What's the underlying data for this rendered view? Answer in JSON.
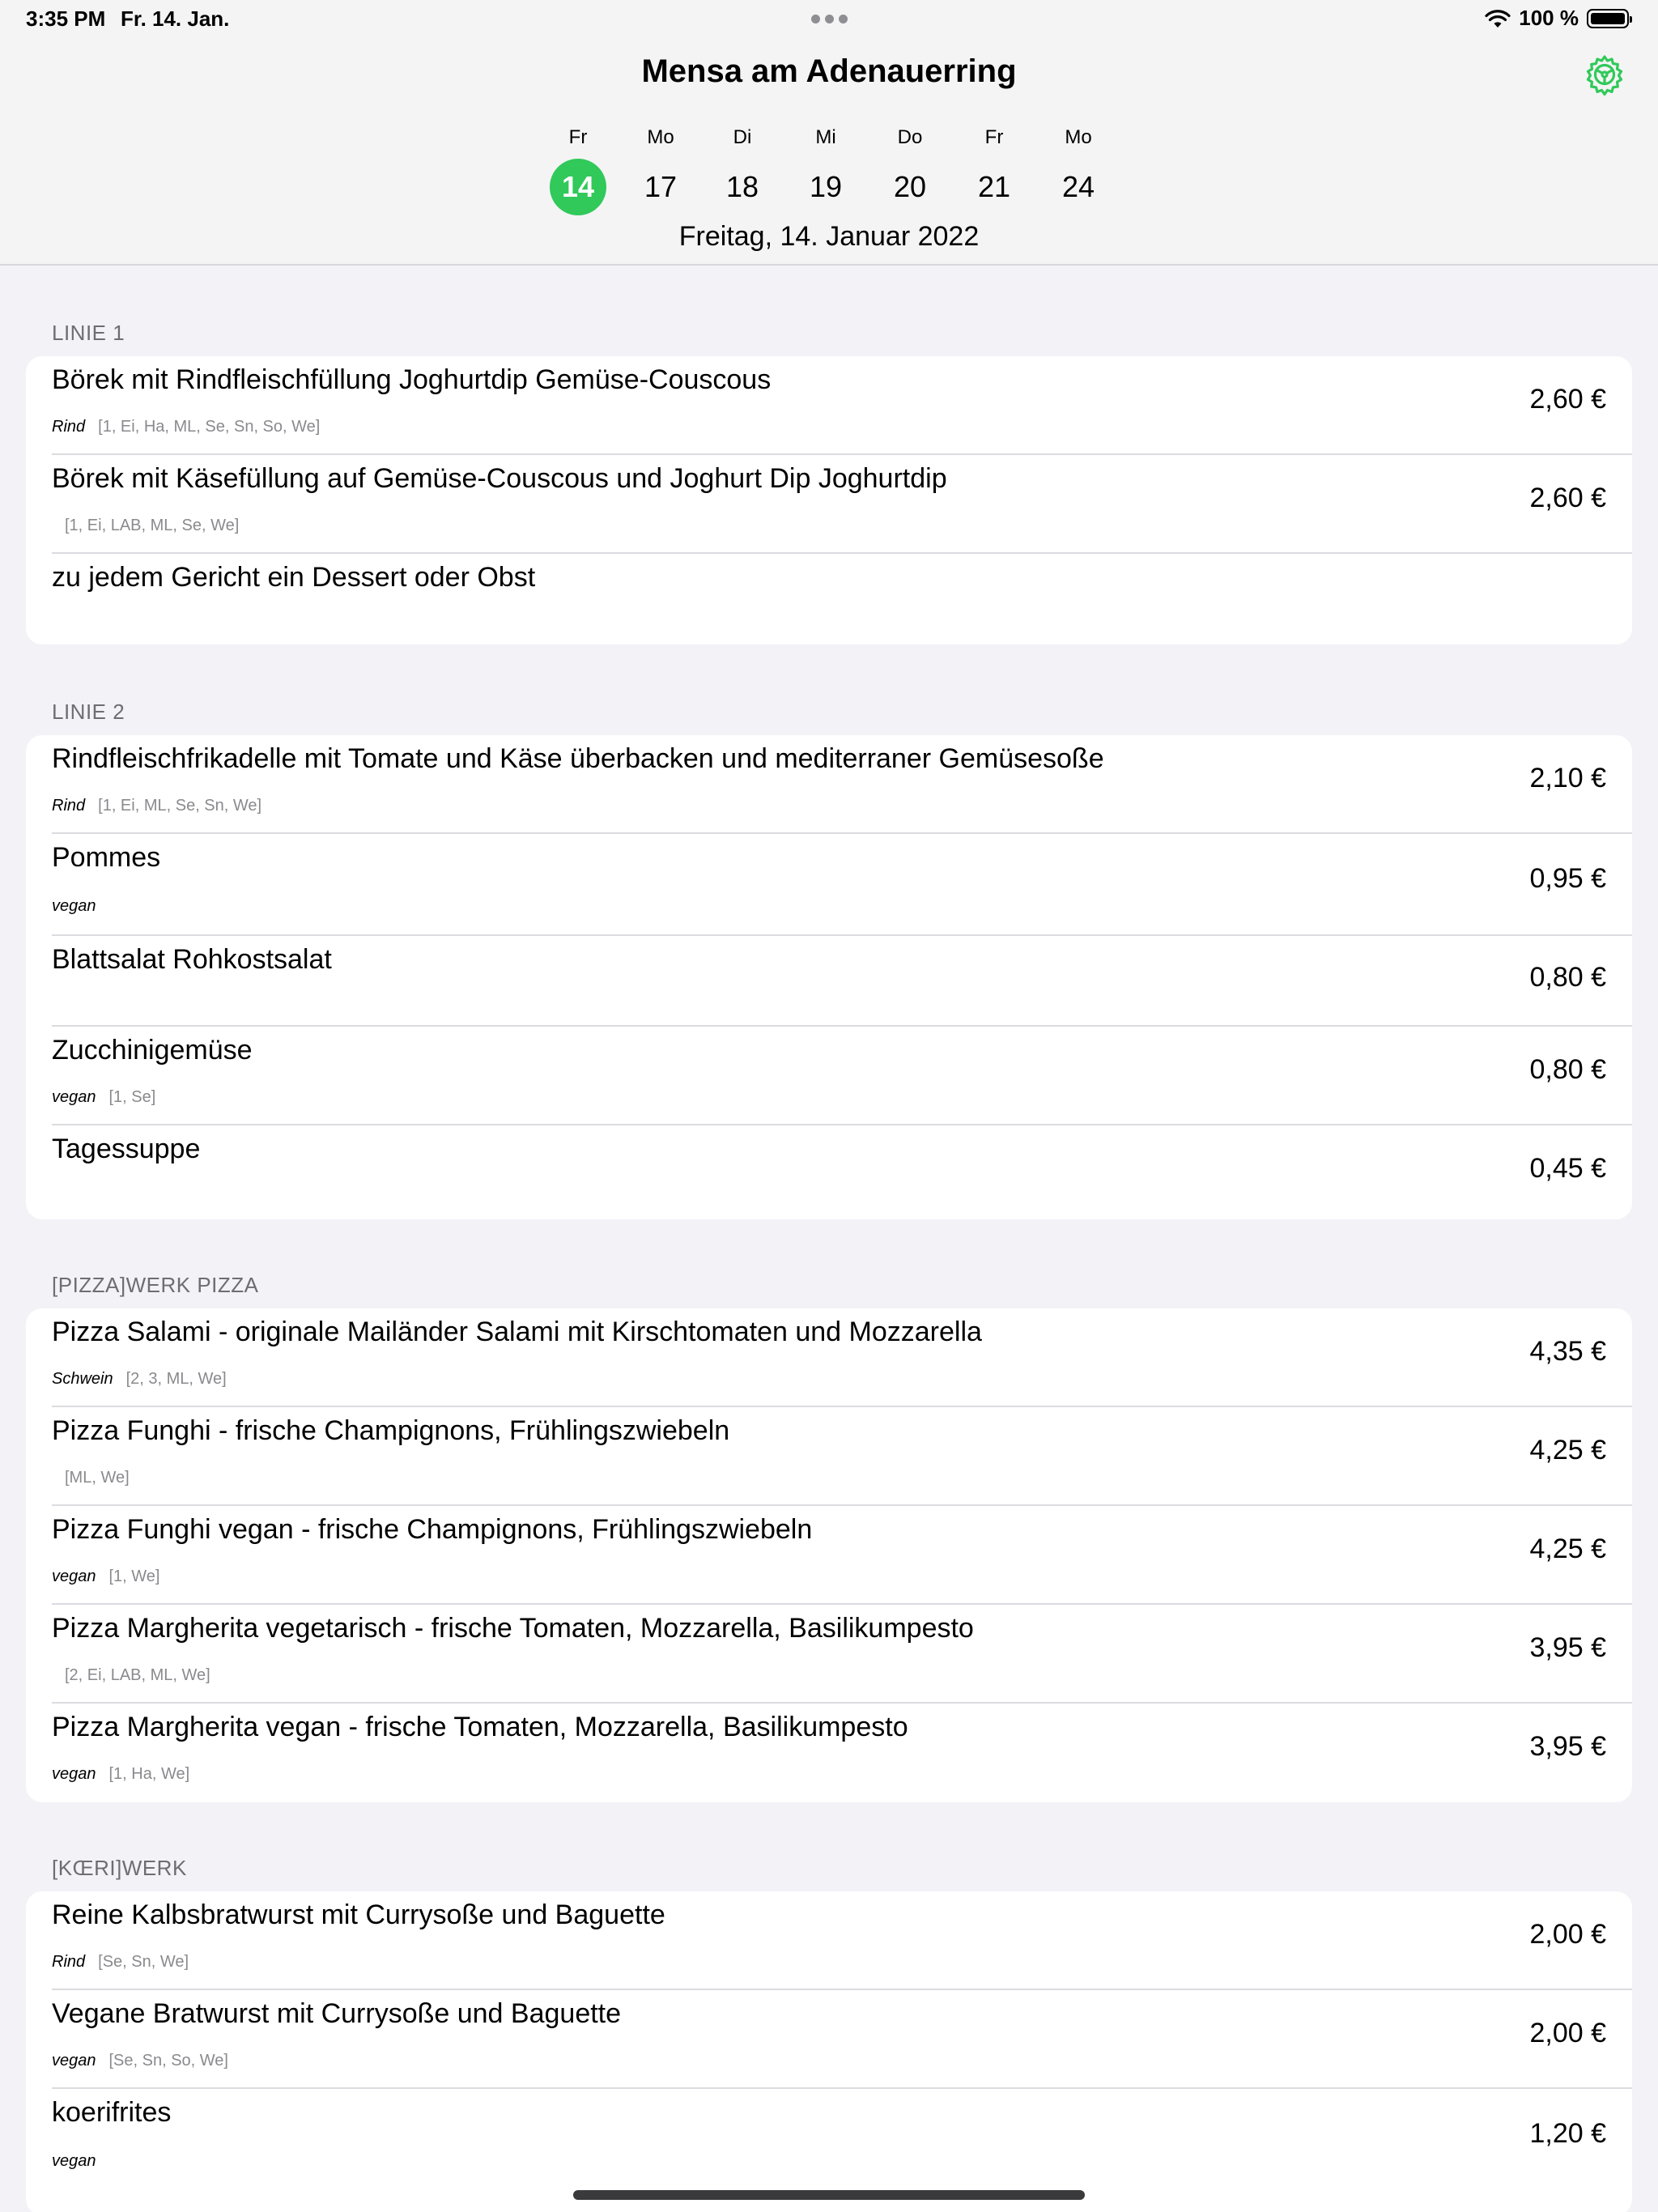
{
  "status_bar": {
    "time": "3:35 PM",
    "date": "Fr. 14. Jan.",
    "battery": "100 %"
  },
  "nav": {
    "title": "Mensa am Adenauerring",
    "settings_icon": "gear-icon",
    "accent_color": "#30c95a"
  },
  "week": {
    "days": [
      {
        "abbr": "Fr",
        "num": "14",
        "selected": true
      },
      {
        "abbr": "Mo",
        "num": "17"
      },
      {
        "abbr": "Di",
        "num": "18"
      },
      {
        "abbr": "Mi",
        "num": "19"
      },
      {
        "abbr": "Do",
        "num": "20"
      },
      {
        "abbr": "Fr",
        "num": "21"
      },
      {
        "abbr": "Mo",
        "num": "24"
      }
    ],
    "selected_date": "Freitag, 14. Januar 2022"
  },
  "sections": [
    {
      "title": "LINIE 1",
      "items": [
        {
          "name": "Börek mit Rindfleischfüllung Joghurtdip Gemüse-Couscous",
          "tag": "Rind",
          "codes": "[1, Ei, Ha, ML, Se, Sn, So, We]",
          "price": "2,60 €"
        },
        {
          "name": "Börek mit Käsefüllung auf Gemüse-Couscous und Joghurt Dip Joghurtdip",
          "tag": "",
          "codes": "[1, Ei, LAB, ML, Se, We]",
          "price": "2,60 €"
        },
        {
          "name": "zu jedem Gericht ein Dessert oder Obst",
          "tag": "",
          "codes": "",
          "price": ""
        }
      ]
    },
    {
      "title": "LINIE 2",
      "items": [
        {
          "name": "Rindfleischfrikadelle mit Tomate und Käse überbacken und mediterraner Gemüsesoße",
          "tag": "Rind",
          "codes": "[1, Ei, ML, Se, Sn, We]",
          "price": "2,10 €"
        },
        {
          "name": "Pommes",
          "tag": "vegan",
          "codes": "",
          "price": "0,95 €"
        },
        {
          "name": "Blattsalat Rohkostsalat",
          "tag": "",
          "codes": "",
          "price": "0,80 €"
        },
        {
          "name": "Zucchinigemüse",
          "tag": "vegan",
          "codes": "[1, Se]",
          "price": "0,80 €"
        },
        {
          "name": "Tagessuppe",
          "tag": "",
          "codes": "",
          "price": "0,45 €"
        }
      ]
    },
    {
      "title": "[PIZZA]WERK PIZZA",
      "items": [
        {
          "name": "Pizza Salami - originale Mailänder Salami mit Kirschtomaten und Mozzarella",
          "tag": "Schwein",
          "codes": "[2, 3, ML, We]",
          "price": "4,35 €"
        },
        {
          "name": "Pizza Funghi - frische Champignons, Frühlingszwiebeln",
          "tag": "",
          "codes": "[ML, We]",
          "price": "4,25 €"
        },
        {
          "name": "Pizza Funghi vegan - frische Champignons, Frühlingszwiebeln",
          "tag": "vegan",
          "codes": "[1, We]",
          "price": "4,25 €"
        },
        {
          "name": "Pizza Margherita vegetarisch - frische Tomaten, Mozzarella, Basilikumpesto",
          "tag": "",
          "codes": "[2, Ei, LAB, ML, We]",
          "price": "3,95 €"
        },
        {
          "name": "Pizza Margherita vegan - frische Tomaten, Mozzarella, Basilikumpesto",
          "tag": "vegan",
          "codes": "[1, Ha, We]",
          "price": "3,95 €"
        }
      ]
    },
    {
      "title": "[KŒRI]WERK",
      "items": [
        {
          "name": "Reine Kalbsbratwurst mit Currysoße und Baguette",
          "tag": "Rind",
          "codes": "[Se, Sn, We]",
          "price": "2,00 €"
        },
        {
          "name": "Vegane Bratwurst mit Currysoße und Baguette",
          "tag": "vegan",
          "codes": "[Se, Sn, So, We]",
          "price": "2,00 €"
        },
        {
          "name": "koerifrites",
          "tag": "vegan",
          "codes": "",
          "price": "1,20 €"
        }
      ]
    }
  ]
}
